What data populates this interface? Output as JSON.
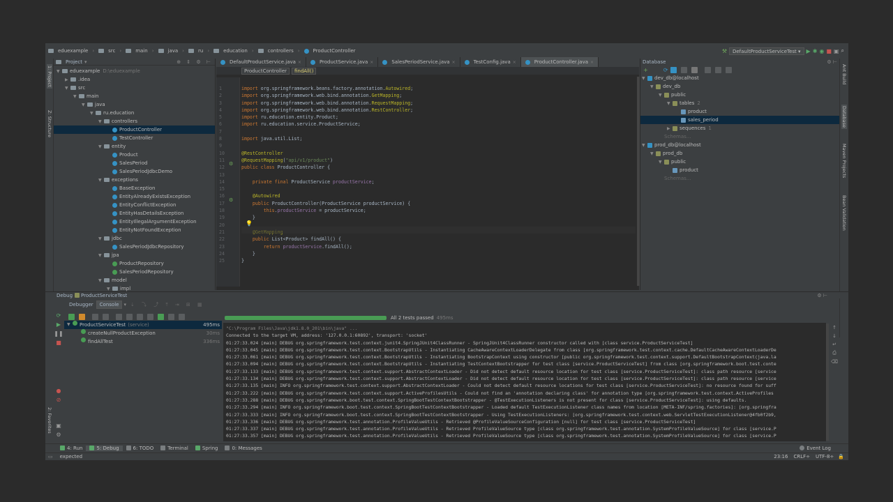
{
  "breadcrumb": [
    "eduexample",
    "src",
    "main",
    "java",
    "ru",
    "education",
    "controllers",
    "ProductController"
  ],
  "run_config": "DefaultProductServiceTest",
  "project_panel": {
    "title": "Project",
    "tree": [
      {
        "label": "eduexample",
        "extra": "D:\\eduexample",
        "depth": 0,
        "type": "folder",
        "arrow": "▼"
      },
      {
        "label": ".idea",
        "depth": 1,
        "type": "folder",
        "arrow": "▶"
      },
      {
        "label": "src",
        "depth": 1,
        "type": "folder",
        "arrow": "▼"
      },
      {
        "label": "main",
        "depth": 2,
        "type": "folder",
        "arrow": "▼"
      },
      {
        "label": "java",
        "depth": 3,
        "type": "folder",
        "arrow": "▼"
      },
      {
        "label": "ru.education",
        "depth": 4,
        "type": "folder",
        "arrow": "▼"
      },
      {
        "label": "controllers",
        "depth": 5,
        "type": "folder",
        "arrow": "▼"
      },
      {
        "label": "ProductController",
        "depth": 6,
        "type": "class",
        "selected": true
      },
      {
        "label": "TestController",
        "depth": 6,
        "type": "class"
      },
      {
        "label": "entity",
        "depth": 5,
        "type": "folder",
        "arrow": "▼"
      },
      {
        "label": "Product",
        "depth": 6,
        "type": "class"
      },
      {
        "label": "SalesPeriod",
        "depth": 6,
        "type": "class"
      },
      {
        "label": "SalesPeriodJdbcDemo",
        "depth": 6,
        "type": "class"
      },
      {
        "label": "exceptions",
        "depth": 5,
        "type": "folder",
        "arrow": "▼"
      },
      {
        "label": "BaseException",
        "depth": 6,
        "type": "class"
      },
      {
        "label": "EntityAlreadyExistsException",
        "depth": 6,
        "type": "class"
      },
      {
        "label": "EntityConflictException",
        "depth": 6,
        "type": "class"
      },
      {
        "label": "EntityHasDetailsException",
        "depth": 6,
        "type": "class"
      },
      {
        "label": "EntityIllegalArgumentException",
        "depth": 6,
        "type": "class"
      },
      {
        "label": "EntityNotFoundException",
        "depth": 6,
        "type": "class"
      },
      {
        "label": "jdbc",
        "depth": 5,
        "type": "folder",
        "arrow": "▼"
      },
      {
        "label": "SalesPeriodJdbcRepository",
        "depth": 6,
        "type": "class"
      },
      {
        "label": "jpa",
        "depth": 5,
        "type": "folder",
        "arrow": "▼"
      },
      {
        "label": "ProductRepository",
        "depth": 6,
        "type": "class",
        "green": true
      },
      {
        "label": "SalesPeriodRepository",
        "depth": 6,
        "type": "class",
        "green": true
      },
      {
        "label": "model",
        "depth": 5,
        "type": "folder",
        "arrow": "▼"
      },
      {
        "label": "impl",
        "depth": 6,
        "type": "folder",
        "arrow": "▼"
      }
    ]
  },
  "left_vtabs": [
    "1: Project",
    "Z: Structure"
  ],
  "editor": {
    "tabs": [
      {
        "label": "DefaultProductService.java"
      },
      {
        "label": "ProductService.java"
      },
      {
        "label": "SalesPeriodService.java"
      },
      {
        "label": "TestConfig.java"
      },
      {
        "label": "ProductController.java",
        "active": true
      }
    ],
    "nav": [
      "ProductController",
      "findAll()"
    ],
    "line_numbers": [
      "1",
      "2",
      "3",
      "4",
      "5",
      "6",
      "7",
      "8",
      "9",
      "10",
      "11",
      "12",
      "13",
      "14",
      "15",
      "16",
      "17",
      "18",
      "19",
      "20",
      "21",
      "22",
      "23",
      "24",
      "25"
    ],
    "lines": [
      "<span class='kw'>import</span> org.springframework.beans.factory.annotation.<span class='ann'>Autowired</span>;",
      "<span class='kw'>import</span> org.springframework.web.bind.annotation.<span class='ann'>GetMapping</span>;",
      "<span class='kw'>import</span> org.springframework.web.bind.annotation.<span class='ann'>RequestMapping</span>;",
      "<span class='kw'>import</span> org.springframework.web.bind.annotation.<span class='ann'>RestController</span>;",
      "<span class='kw'>import</span> ru.education.entity.Product;",
      "<span class='kw'>import</span> ru.education.service.ProductService;",
      "",
      "<span class='kw'>import</span> java.util.List;",
      "",
      "<span class='ann'>@RestController</span>",
      "<span class='ann'>@RequestMapping</span>(<span class='str'>\"api/v1/product\"</span>)",
      "<span class='kw'>public class</span> ProductController {",
      "",
      "    <span class='kw'>private final</span> ProductService <span class='fld'>productService</span>;",
      "",
      "    <span class='ann'>@Autowired</span>",
      "    <span class='kw'>public</span> ProductController(ProductService productService) {",
      "        <span class='kw'>this</span>.<span class='fld'>productService</span> = productService;",
      "    }",
      "",
      "    <span class='ann'>@GetMapping</span>",
      "    <span class='kw'>public</span> List&lt;Product&gt; findAll() {",
      "        <span class='kw'>return</span> <span class='fld'>productService</span>.findAll();",
      "    }",
      "}"
    ]
  },
  "database": {
    "title": "Database",
    "tree": [
      {
        "label": "dev_db@localhost",
        "depth": 0,
        "arrow": "▼"
      },
      {
        "label": "dev_db",
        "depth": 1,
        "arrow": "▼"
      },
      {
        "label": "public",
        "depth": 2,
        "arrow": "▼"
      },
      {
        "label": "tables",
        "extra": "2",
        "depth": 3,
        "arrow": "▼"
      },
      {
        "label": "product",
        "depth": 4
      },
      {
        "label": "sales_period",
        "depth": 4,
        "selected": true
      },
      {
        "label": "sequences",
        "extra": "1",
        "depth": 3,
        "arrow": "▶"
      },
      {
        "label": "Schemas...",
        "depth": 2,
        "dim": true
      },
      {
        "label": "prod_db@localhost",
        "depth": 0,
        "arrow": "▼"
      },
      {
        "label": "prod_db",
        "depth": 1,
        "arrow": "▼"
      },
      {
        "label": "public",
        "depth": 2,
        "arrow": "▼"
      },
      {
        "label": "product",
        "depth": 3
      },
      {
        "label": "Schemas...",
        "depth": 2,
        "dim": true
      }
    ]
  },
  "right_vtabs": [
    "Ant Build",
    "Database",
    "Maven Projects",
    "Bean Validation"
  ],
  "debug": {
    "title": "Debug",
    "config": "ProductServiceTest",
    "tabs": [
      "Debugger",
      "Console"
    ],
    "status": "All 2 tests passed",
    "status_time": "495ms",
    "progress": 1.0,
    "tests": [
      {
        "label": "ProductServiceTest",
        "extra": "(service)",
        "time": "495ms",
        "depth": 0,
        "selected": true
      },
      {
        "label": "createNullProductException",
        "time": "30ms",
        "depth": 1
      },
      {
        "label": "findAllTest",
        "time": "336ms",
        "depth": 1
      }
    ],
    "console": [
      "\"C:\\Program Files\\Java\\jdk1.8.0_201\\bin\\java\" ...",
      "Connected to the target VM, address: '127.0.0.1:60892', transport: 'socket'",
      "01:27:33.024 [main] DEBUG org.springframework.test.context.junit4.SpringJUnit4ClassRunner - SpringJUnit4ClassRunner constructor called with [class service.ProductServiceTest]",
      "01:27:33.045 [main] DEBUG org.springframework.test.context.BootstrapUtils - Instantiating CacheAwareContextLoaderDelegate from class [org.springframework.test.context.cache.DefaultCacheAwareContextLoaderDe",
      "01:27:33.061 [main] DEBUG org.springframework.test.context.BootstrapUtils - Instantiating BootstrapContext using constructor [public org.springframework.test.context.support.DefaultBootstrapContext(java.la",
      "01:27:33.094 [main] DEBUG org.springframework.test.context.BootstrapUtils - Instantiating TestContextBootstrapper for test class [service.ProductServiceTest] from class [org.springframework.boot.test.conte",
      "01:27:33.133 [main] DEBUG org.springframework.test.context.support.AbstractContextLoader - Did not detect default resource location for test class [service.ProductServiceTest]: class path resource [service",
      "01:27:33.134 [main] DEBUG org.springframework.test.context.support.AbstractContextLoader - Did not detect default resource location for test class [service.ProductServiceTest]: class path resource [service",
      "01:27:33.135 [main] INFO org.springframework.test.context.support.AbstractContextLoader - Could not detect default resource locations for test class [service.ProductServiceTest]: no resource found for suff",
      "01:27:33.222 [main] DEBUG org.springframework.test.context.support.ActiveProfilesUtils - Could not find an 'annotation declaring class' for annotation type [org.springframework.test.context.ActiveProfiles",
      "01:27:33.288 [main] DEBUG org.springframework.boot.test.context.SpringBootTestContextBootstrapper - @TestExecutionListeners is not present for class [service.ProductServiceTest]: using defaults.",
      "01:27:33.294 [main] INFO org.springframework.boot.test.context.SpringBootTestContextBootstrapper - Loaded default TestExecutionListener class names from location [META-INF/spring.factories]: [org.springfra",
      "01:27:33.333 [main] INFO org.springframework.boot.test.context.SpringBootTestContextBootstrapper - Using TestExecutionListeners: [org.springframework.test.context.web.ServletTestExecutionListener@4fb0f2b9,",
      "01:27:33.336 [main] DEBUG org.springframework.test.annotation.ProfileValueUtils - Retrieved @ProfileValueSourceConfiguration [null] for test class [service.ProductServiceTest]",
      "01:27:33.337 [main] DEBUG org.springframework.test.annotation.ProfileValueUtils - Retrieved ProfileValueSource type [class org.springframework.test.annotation.SystemProfileValueSource] for class [service.P",
      "01:27:33.357 [main] DEBUG org.springframework.test.annotation.ProfileValueUtils - Retrieved ProfileValueSource type [class org.springframework.test.annotation.SystemProfileValueSource] for class [service.P"
    ]
  },
  "left_debug_vtabs": [
    "2: Favorites"
  ],
  "bottom_tabs": [
    {
      "label": "4: Run",
      "icon": "run-icon"
    },
    {
      "label": "5: Debug",
      "icon": "debug-icon",
      "active": true
    },
    {
      "label": "6: TODO",
      "icon": "todo-icon"
    },
    {
      "label": "Terminal",
      "icon": "terminal-icon"
    },
    {
      "label": "Spring",
      "icon": "spring-icon"
    },
    {
      "label": "0: Messages",
      "icon": "messages-icon"
    }
  ],
  "event_log": "Event Log",
  "status_bar": {
    "message": "expected",
    "position": "23:16",
    "line_sep": "CRLF÷",
    "encoding": "UTF-8÷"
  },
  "colors": {
    "accent": "#3592c4",
    "pass": "#499c54",
    "bg": "#2b2b2b",
    "panel": "#3c3f41"
  }
}
